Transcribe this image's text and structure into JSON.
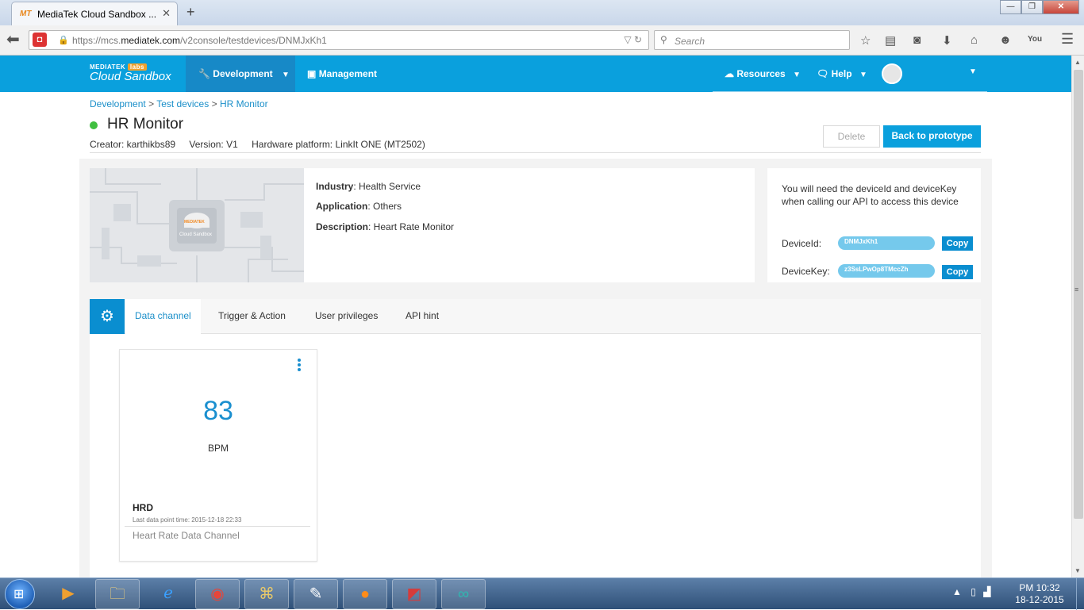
{
  "browser": {
    "tab_title": "MediaTek Cloud Sandbox ...",
    "tab_favicon": "MT",
    "tab_close": "✕",
    "new_tab": "+",
    "url_prefix": "https://mcs.",
    "url_domain": "mediatek.com",
    "url_path": "/v2console/testdevices/DNMJxKh1",
    "search_placeholder": "Search",
    "win_min": "—",
    "win_max": "❐",
    "win_close": "✕"
  },
  "header": {
    "logo_brand": "MEDIATEK",
    "logo_labs": "labs",
    "logo_main": "Cloud Sandbox",
    "nav_development": "Development",
    "nav_management": "Management",
    "nav_resources": "Resources",
    "nav_help": "Help"
  },
  "breadcrumb": {
    "items": [
      "Development",
      "Test devices",
      "HR Monitor"
    ],
    "separator": ">"
  },
  "device": {
    "name": "HR Monitor",
    "status_color": "#3fbf3f",
    "creator": "Creator: karthikbs89",
    "version": "Version: V1",
    "platform": "Hardware platform: LinkIt ONE (MT2502)",
    "industry_label": "Industry",
    "industry": ": Health Service",
    "application_label": "Application",
    "application": ": Others",
    "description_label": "Description",
    "description": ": Heart Rate Monitor",
    "image_logo": "MEDIATEK",
    "image_caption": "Cloud Sandbox"
  },
  "actions": {
    "delete": "Delete",
    "back": "Back to prototype"
  },
  "keys": {
    "note": "You will need the deviceId and deviceKey when calling our API to access this device",
    "device_id_label": "DeviceId:",
    "device_id": "DNMJxKh1",
    "device_key_label": "DeviceKey:",
    "device_key": "z3SsLPwOp8TMccZh",
    "copy": "Copy"
  },
  "tabs": {
    "items": [
      "Data channel",
      "Trigger & Action",
      "User privileges",
      "API hint"
    ],
    "active": "Data channel"
  },
  "channel_card": {
    "value": "83",
    "unit": "BPM",
    "name": "HRD",
    "last_time": "Last data point time: 2015-12-18 22:33",
    "description": "Heart Rate Data Channel"
  },
  "taskbar": {
    "clock_time": "PM 10:32",
    "clock_date": "18-12-2015"
  },
  "colors": {
    "accent": "#0aa0dd",
    "accent_dark": "#1789c7",
    "value_blue": "#1a8fcf"
  }
}
